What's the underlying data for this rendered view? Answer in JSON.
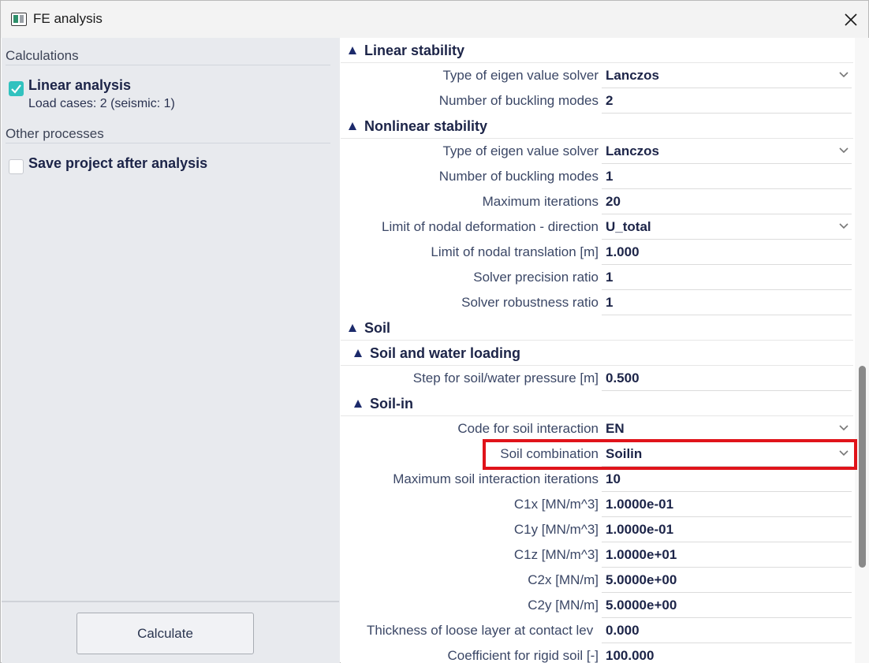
{
  "window": {
    "title": "FE analysis"
  },
  "left": {
    "calculations_header": "Calculations",
    "linear_title": "Linear analysis",
    "linear_sub": "Load cases: 2 (seismic: 1)",
    "other_header": "Other processes",
    "save_title": "Save project after analysis",
    "calculate_label": "Calculate"
  },
  "groups": {
    "linear_stability": "Linear stability",
    "nonlinear_stability": "Nonlinear stability",
    "soil": "Soil",
    "soil_water": "Soil and water loading",
    "soil_in": "Soil-in"
  },
  "props": [
    {
      "label": "Type of eigen value solver",
      "value": "Lanczos",
      "dropdown": true
    },
    {
      "label": "Number of buckling modes",
      "value": "2",
      "dropdown": false
    },
    {
      "label": "Type of eigen value solver",
      "value": "Lanczos",
      "dropdown": true
    },
    {
      "label": "Number of buckling modes",
      "value": "1",
      "dropdown": false
    },
    {
      "label": "Maximum iterations",
      "value": "20",
      "dropdown": false
    },
    {
      "label": "Limit of nodal deformation - direction",
      "value": "U_total",
      "dropdown": true
    },
    {
      "label": "Limit of nodal translation [m]",
      "value": "1.000",
      "dropdown": false
    },
    {
      "label": "Solver precision ratio",
      "value": "1",
      "dropdown": false
    },
    {
      "label": "Solver robustness ratio",
      "value": "1",
      "dropdown": false
    },
    {
      "label": "Step for soil/water pressure [m]",
      "value": "0.500",
      "dropdown": false
    },
    {
      "label": "Code for soil interaction",
      "value": "EN",
      "dropdown": true
    },
    {
      "label": "Soil combination",
      "value": "Soilin",
      "dropdown": true
    },
    {
      "label": "Maximum soil interaction iterations",
      "value": "10",
      "dropdown": false
    },
    {
      "label": "C1x [MN/m^3]",
      "value": "1.0000e-01",
      "dropdown": false
    },
    {
      "label": "C1y [MN/m^3]",
      "value": "1.0000e-01",
      "dropdown": false
    },
    {
      "label": "C1z [MN/m^3]",
      "value": "1.0000e+01",
      "dropdown": false
    },
    {
      "label": "C2x [MN/m]",
      "value": "5.0000e+00",
      "dropdown": false
    },
    {
      "label": "C2y [MN/m]",
      "value": "5.0000e+00",
      "dropdown": false
    },
    {
      "label": "Thickness of loose layer at contact lev",
      "value": "0.000",
      "dropdown": false
    },
    {
      "label": "Coefficient for rigid soil [-]",
      "value": "100.000",
      "dropdown": false
    }
  ],
  "colors": {
    "highlight": "#e0131a",
    "check_on": "#31c2bf",
    "accent_text": "#1c2448"
  }
}
